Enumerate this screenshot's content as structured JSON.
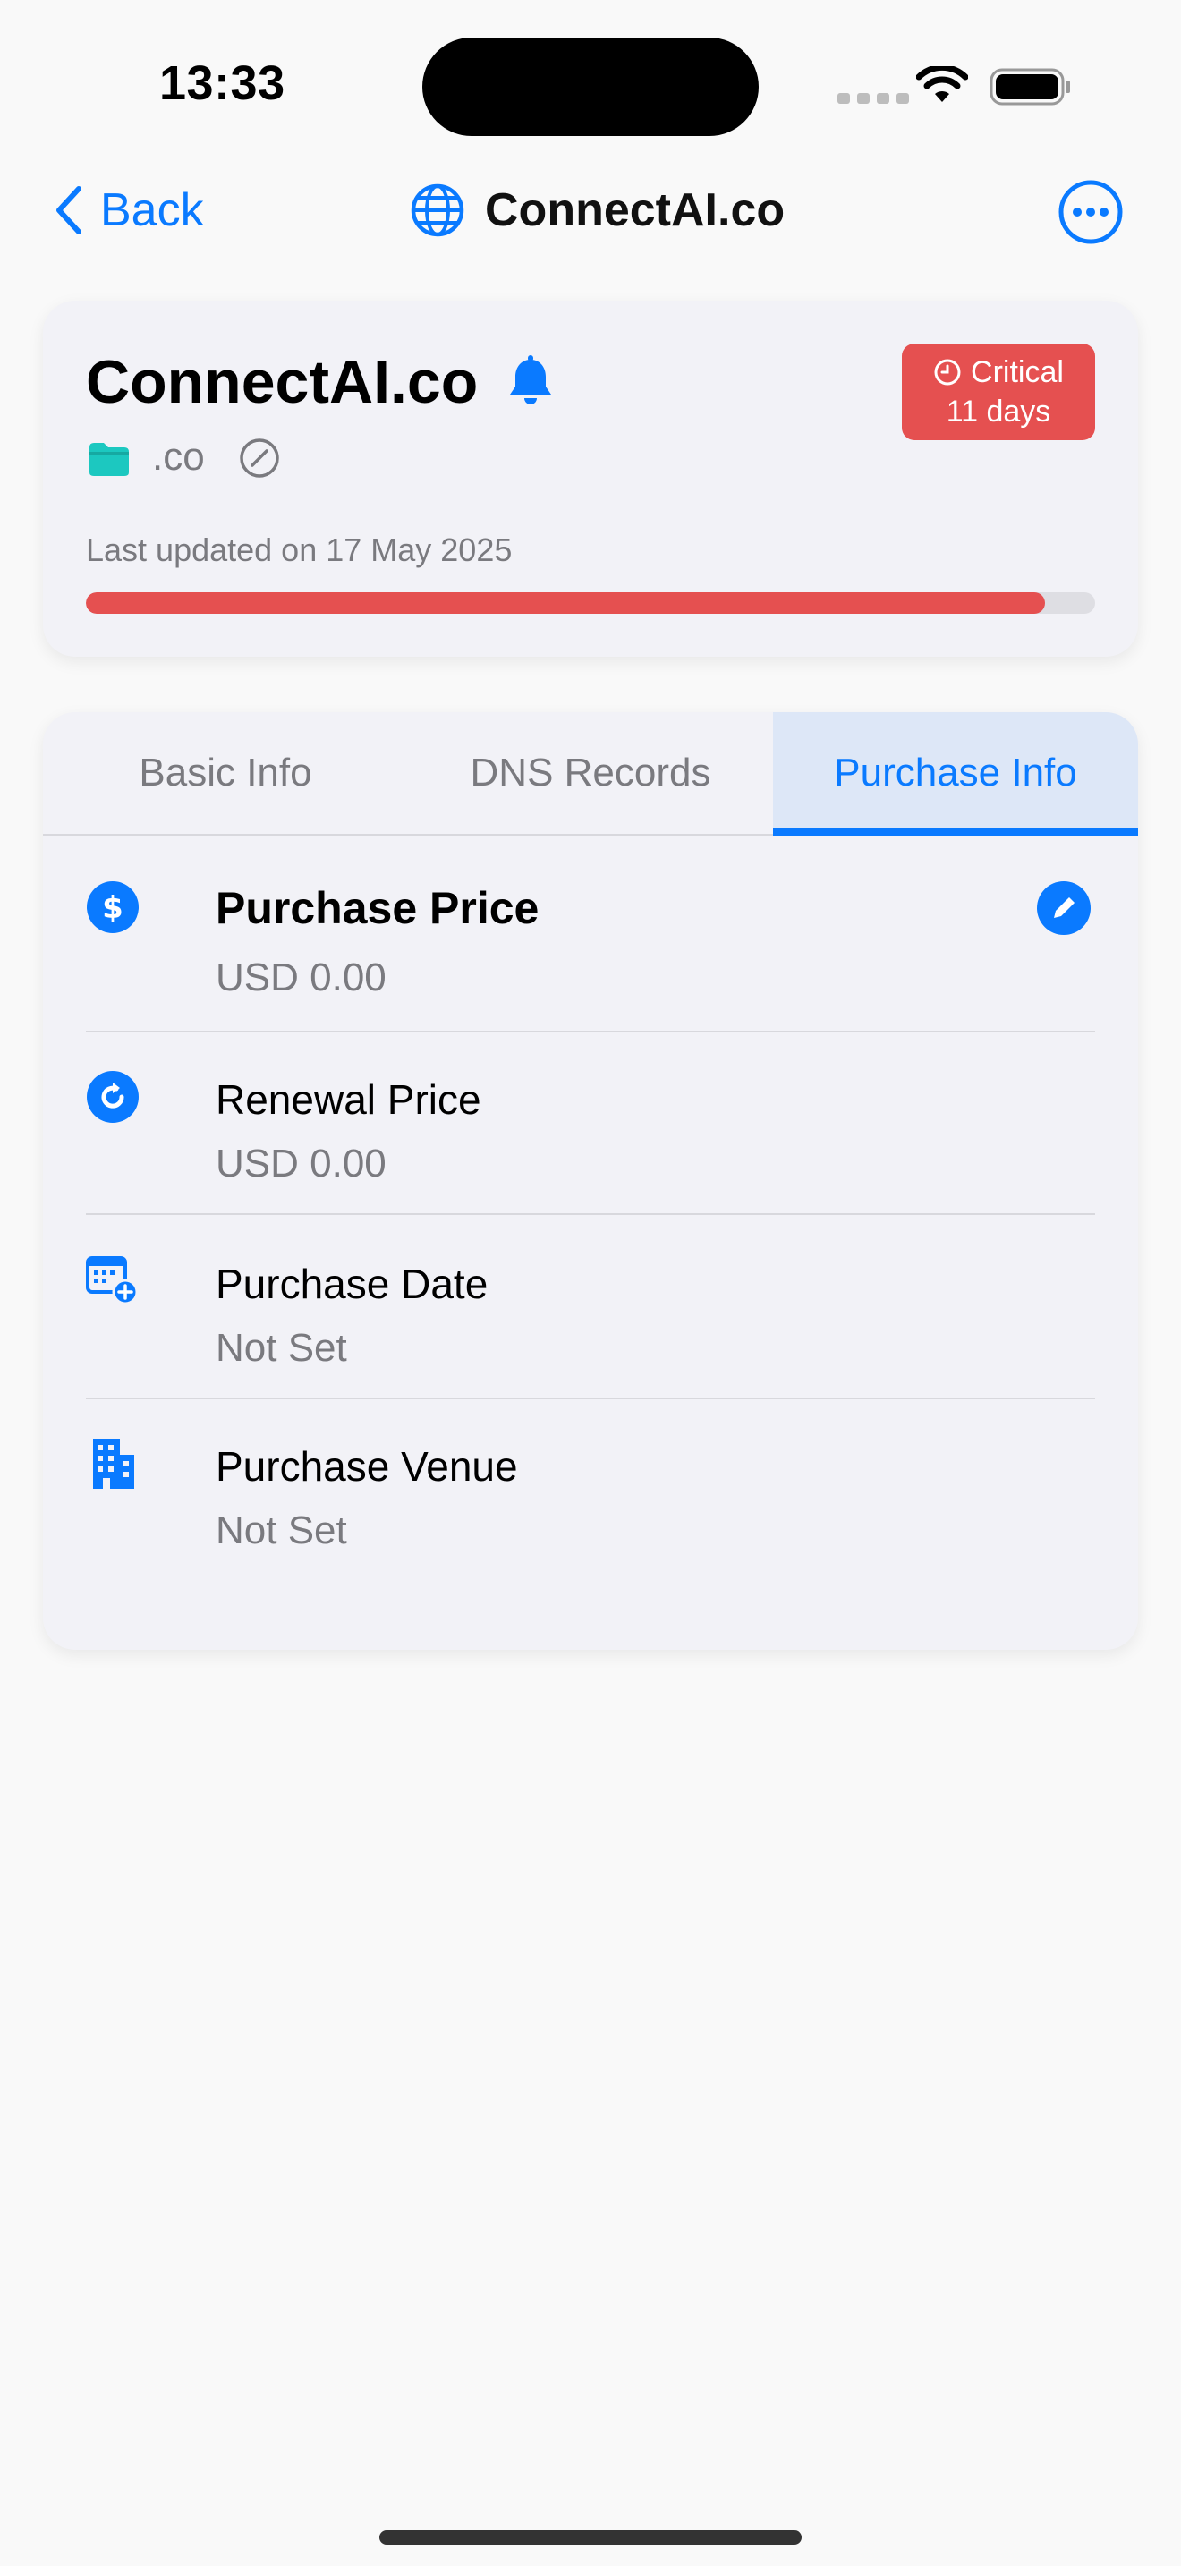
{
  "status_bar": {
    "time": "13:33"
  },
  "nav": {
    "back_label": "Back",
    "title": "ConnectAI.co",
    "accent_color": "#0a7aff"
  },
  "summary": {
    "domain": "ConnectAI.co",
    "badge": {
      "status": "Critical",
      "remaining": "11 days",
      "color": "#e55050"
    },
    "tld": ".co",
    "last_updated": "Last updated on 17 May 2025",
    "progress_fraction": 0.95
  },
  "tabs": [
    {
      "label": "Basic Info",
      "active": false
    },
    {
      "label": "DNS Records",
      "active": false
    },
    {
      "label": "Purchase Info",
      "active": true
    }
  ],
  "purchase_info": {
    "rows": [
      {
        "label": "Purchase Price",
        "value": "USD 0.00",
        "icon": "dollar-circle-icon"
      },
      {
        "label": "Renewal Price",
        "value": "USD 0.00",
        "icon": "renew-circle-icon"
      },
      {
        "label": "Purchase Date",
        "value": "Not Set",
        "icon": "calendar-add-icon"
      },
      {
        "label": "Purchase Venue",
        "value": "Not Set",
        "icon": "building-icon"
      }
    ]
  }
}
